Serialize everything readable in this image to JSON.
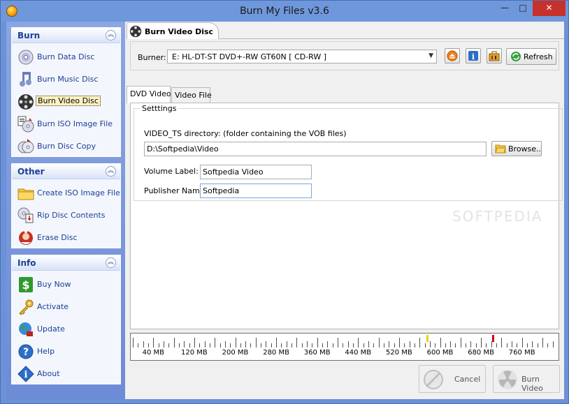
{
  "window": {
    "title": "Burn My Files v3.6",
    "minimize": "—",
    "maximize": "□",
    "close": "✕"
  },
  "sidebar": {
    "groups": [
      {
        "title": "Burn",
        "items": [
          {
            "label": "Burn Data Disc",
            "icon": "data-disc-icon"
          },
          {
            "label": "Burn Music Disc",
            "icon": "music-disc-icon"
          },
          {
            "label": "Burn Video Disc",
            "icon": "video-disc-icon",
            "selected": true
          },
          {
            "label": "Burn ISO Image File",
            "icon": "iso-file-icon"
          },
          {
            "label": "Burn Disc Copy",
            "icon": "disc-copy-icon"
          }
        ]
      },
      {
        "title": "Other",
        "items": [
          {
            "label": "Create ISO Image File",
            "icon": "folder-icon"
          },
          {
            "label": "Rip Disc Contents",
            "icon": "rip-disc-icon"
          },
          {
            "label": "Erase Disc",
            "icon": "erase-disc-icon"
          }
        ]
      },
      {
        "title": "Info",
        "items": [
          {
            "label": "Buy Now",
            "icon": "dollar-icon"
          },
          {
            "label": "Activate",
            "icon": "key-icon"
          },
          {
            "label": "Update",
            "icon": "globe-icon"
          },
          {
            "label": "Help",
            "icon": "help-icon"
          },
          {
            "label": "About",
            "icon": "info-icon"
          }
        ]
      }
    ]
  },
  "main": {
    "page_tab": "Burn Video Disc",
    "burner_label": "Burner:",
    "burner_value": "E: HL-DT-ST DVD+-RW GT60N [ CD-RW ]",
    "refresh_label": "Refresh",
    "tabs": [
      {
        "label": "DVD Video",
        "active": true
      },
      {
        "label": "Video File",
        "active": false
      }
    ],
    "settings_legend": "Setttings",
    "dir_label": "VIDEO_TS directory: (folder containing the VOB files)",
    "dir_value": "D:\\Softpedia\\Video",
    "browse_label": "Browse..",
    "volume_label": "Volume Label:",
    "volume_value": "Softpedia Video",
    "publisher_label": "Publisher Name:",
    "publisher_value": "Softpedia",
    "watermark": "SOFTPEDIA"
  },
  "ruler": {
    "labels": [
      "40 MB",
      "120 MB",
      "200 MB",
      "280 MB",
      "360 MB",
      "440 MB",
      "520 MB",
      "600 MB",
      "680 MB",
      "760 MB"
    ],
    "markers": [
      {
        "name": "yellow-capacity-marker",
        "color": "#f0d000",
        "value_mb": 575
      },
      {
        "name": "red-capacity-marker",
        "color": "#d00000",
        "value_mb": 703
      }
    ]
  },
  "buttons": {
    "cancel": "Cancel",
    "burn": "Burn Video"
  },
  "colors": {
    "sidebar_text": "#1b3f94",
    "frame": "#6f97db",
    "close": "#c7312b"
  }
}
